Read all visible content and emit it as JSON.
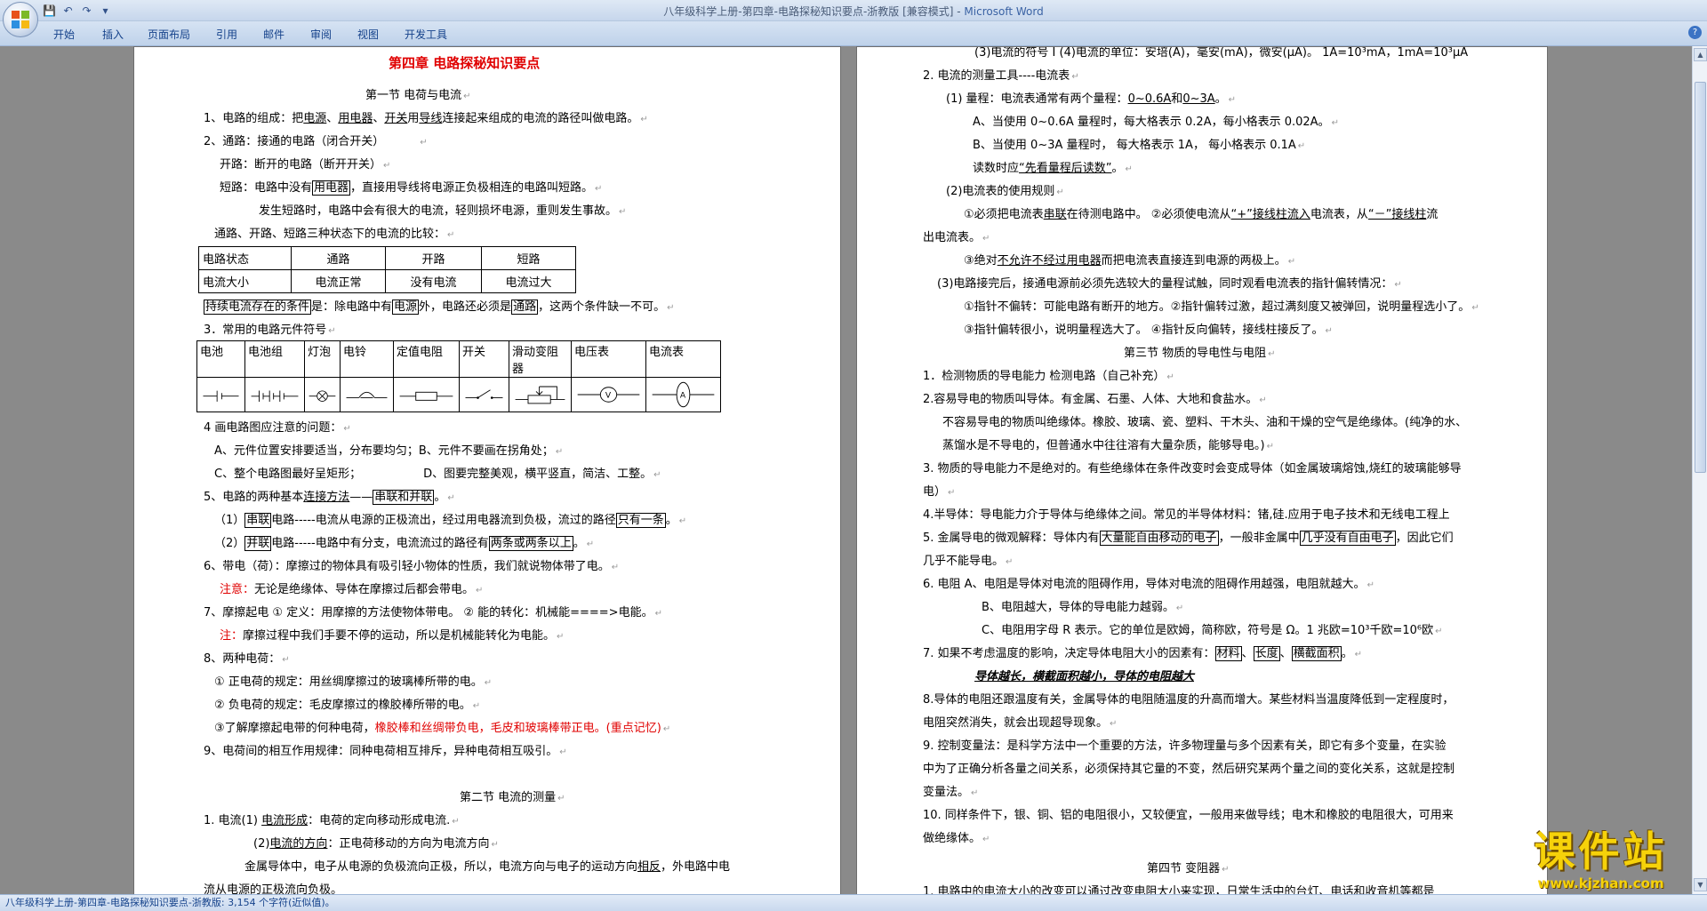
{
  "window": {
    "title": "八年级科学上册-第四章-电路探秘知识要点-浙教版 [兼容模式] - ",
    "app_name": "Microsoft Word",
    "help_label": "?"
  },
  "qat": {
    "save": "💾",
    "undo": "↶",
    "redo": "↷",
    "customize": "▾"
  },
  "ribbon_tabs": [
    "开始",
    "插入",
    "页面布局",
    "引用",
    "邮件",
    "审阅",
    "视图",
    "开发工具"
  ],
  "status_bar": "八年级科学上册-第四章-电路探秘知识要点-浙教版: 3,154 个字符(近似值)。",
  "watermark": {
    "text": "课件站",
    "url": "www.kjzhan.com"
  },
  "left_page": {
    "title": "第四章  电路探秘知识要点",
    "section1": "第一节   电荷与电流",
    "l1": [
      "1、电路的组成：把",
      "电源",
      "、",
      "用电器",
      "、",
      "开关",
      "用",
      "导线",
      "连接起来组成的电流的路径叫做电路。"
    ],
    "l2": "2、通路：接通的电路（闭合开关）",
    "l3": "开路：断开的电路（断开开关）",
    "l4": [
      "短路：电路中没有",
      "用电器",
      "，直接用导线将电源正负极相连的电路叫短路。"
    ],
    "l5": "发生短路时，电路中会有很大的电流，轻则损坏电源，重则发生事故。",
    "l6": "通路、开路、短路三种状态下的电流的比较：",
    "table1": [
      [
        "电路状态",
        "通路",
        "开路",
        "短路"
      ],
      [
        "电流大小",
        "电流正常",
        "没有电流",
        "电流过大"
      ]
    ],
    "l7": [
      "持续电流存在的条件",
      "是：除电路中有",
      "电源",
      "外，电路还必须是",
      "通路",
      "，这两个条件缺一不可。"
    ],
    "l8": "3．常用的电路元件符号",
    "table2": [
      "电池",
      "电池组",
      "灯泡",
      "电铃",
      "定值电阻",
      "开关",
      "滑动变阻器",
      "电压表",
      "电流表"
    ],
    "l9": "4 画电路图应注意的问题：",
    "l10": "A、元件位置安排要适当，分布要均匀；B、元件不要画在拐角处；",
    "l11": [
      "C、整个电路图最好呈矩形；",
      "D、图要完整美观，横平竖直，简洁、工整。"
    ],
    "l12": [
      "5、电路的两种基本",
      "连接方法",
      "——",
      "串联和并联",
      "。"
    ],
    "l13": [
      "（1）",
      "串联",
      "电路-----电流从电源的正极流出，经过用电器流到负极，流过的路径",
      "只有一条",
      "。"
    ],
    "l14": [
      "（2）",
      "并联",
      "电路-----电路中有分支，电流流过的路径有",
      "两条或两条以上",
      "。"
    ],
    "l15": "6、带电（荷）：摩擦过的物体具有吸引轻小物体的性质，我们就说物体带了电。",
    "l16": [
      "注意：",
      "无论是绝缘体、导体在摩擦过后都会带电。"
    ],
    "l17": "7、摩擦起电   ①  定义：用摩擦的方法使物体带电。     ②  能的转化：机械能====>电能。",
    "l18": [
      "注：",
      "摩擦过程中我们手要不停的运动，所以是机械能转化为电能。"
    ],
    "l19": "8、两种电荷：",
    "l20": "①  正电荷的规定：用丝绸摩擦过的玻璃棒所带的电。",
    "l21": "②  负电荷的规定：毛皮摩擦过的橡胶棒所带的电。",
    "l22": [
      "③了解摩擦起电带的何种电荷，",
      "橡胶棒和丝绸带负电，毛皮和玻璃棒带正电。(重点记忆)"
    ],
    "l23": "9、电荷间的相互作用规律：同种电荷相互排斥，异种电荷相互吸引。",
    "section2": "第二节  电流的测量",
    "l24": [
      "1.  电流(1)  ",
      "电流形成",
      "：电荷的定向移动形成电流."
    ],
    "l25": [
      "(2)",
      "电流的方向",
      "：正电荷移动的方向为电流方向"
    ],
    "l26": [
      "金属导体中，电子从电源的负极流向正极，所以，电流方向与电子的运动方向",
      "相反",
      "，外电路中电"
    ],
    "l27": "流从电源的正极流向负极。"
  },
  "right_page": {
    "r1": "(3)电流的符号  I   (4)电流的单位：安培(A)，毫安(mA)，微安(μA)。    1A=10³mA，1mA=10³μA",
    "r2": "2.  电流的测量工具----电流表",
    "r3": [
      "(1) 量程：电流表通常有两个量程：",
      "0~0.6A",
      "和",
      "0~3A",
      "。"
    ],
    "r4": "A、当使用 0~0.6A 量程时，每大格表示 0.2A，每小格表示 0.02A。",
    "r5": "B、当使用 0~3A 量程时，   每大格表示 1A，   每小格表示 0.1A",
    "r6": [
      "读数时应",
      "“先看量程后读数”",
      "。"
    ],
    "r7": "(2)电流表的使用规则",
    "r8": [
      "①必须把电流表",
      "串联",
      "在待测电路中。  ②必须使电流从",
      "“+”接线柱流入",
      "电流表，从",
      "“－”接线柱",
      "流"
    ],
    "r9": "出电流表。",
    "r10": [
      "③绝对",
      "不允许不经过用电器",
      "而把电流表直接连到电源的两极上。"
    ],
    "r11": "(3)电路接完后，接通电源前必须先选较大的量程试触，同时观看电流表的指针偏转情况：",
    "r12": "①指针不偏转：可能电路有断开的地方。②指针偏转过激，超过满刻度又被弹回，说明量程选小了。",
    "r13": "③指针偏转很小，说明量程选大了。        ④指针反向偏转，接线柱接反了。",
    "section3": "第三节   物质的导电性与电阻",
    "r14": "1．检测物质的导电能力     检测电路（自己补充）",
    "r15": "2.容易导电的物质叫导体。有金属、石墨、人体、大地和食盐水。",
    "r16": "不容易导电的物质叫绝缘体。橡胶、玻璃、瓷、塑料、干木头、油和干燥的空气是绝缘体。(纯净的水、",
    "r17": "蒸馏水是不导电的，但普通水中往往溶有大量杂质，能够导电。)",
    "r18": "3. 物质的导电能力不是绝对的。有些绝缘体在条件改变时会变成导体（如金属玻璃熔蚀,烧红的玻璃能够导",
    "r19": "电）",
    "r20": "4.半导体：导电能力介于导体与绝缘体之间。常见的半导体材料：锗,硅.应用于电子技术和无线电工程上",
    "r21": [
      "5. 金属导电的微观解释：导体内有",
      "大量能自由移动的电子",
      "，一般非金属中",
      "几乎没有自由电子",
      "，因此它们"
    ],
    "r22": "几乎不能导电。",
    "r23": "6.  电阻   A、电阻是导体对电流的阻碍作用，导体对电流的阻碍作用越强，电阻就越大。",
    "r24": "B、电阻越大，导体的导电能力越弱。",
    "r25": "C、电阻用字母 R 表示。它的单位是欧姆，简称欧，符号是    Ω。1 兆欧=10³千欧=10⁶欧",
    "r26": [
      "7. 如果不考虑温度的影响，决定导体电阻大小的因素有：",
      "材料",
      "、",
      "长度",
      "、",
      "横截面积",
      "。"
    ],
    "r27": "导体越长，横截面积越小，导体的电阻越大",
    "r28": "8.导体的电阻还跟温度有关，金属导体的电阻随温度的升高而增大。某些材料当温度降低到一定程度时，",
    "r29": "电阻突然消失，就会出现超导现象。",
    "r30": "9. 控制变量法：是科学方法中一个重要的方法，许多物理量与多个因素有关，即它有多个变量，在实验",
    "r31": "中为了正确分析各量之间关系，必须保持其它量的不变，然后研究某两个量之间的变化关系，这就是控制",
    "r32": "变量法。",
    "r33": "10. 同样条件下，银、铜、铝的电阻很小，又较便宜，一般用来做导线；电木和橡胶的电阻很大，可用来",
    "r34": "做绝缘体。",
    "section4": "第四节   变阻器",
    "r35": "1. 电路中的电流大小的改变可以通过改变电阻大小来实现，日常生活中的台灯、电话和收音机等都是"
  },
  "colors": {
    "accent": "#15428b",
    "red": "#e00000",
    "watermark": "#f6d20a"
  }
}
